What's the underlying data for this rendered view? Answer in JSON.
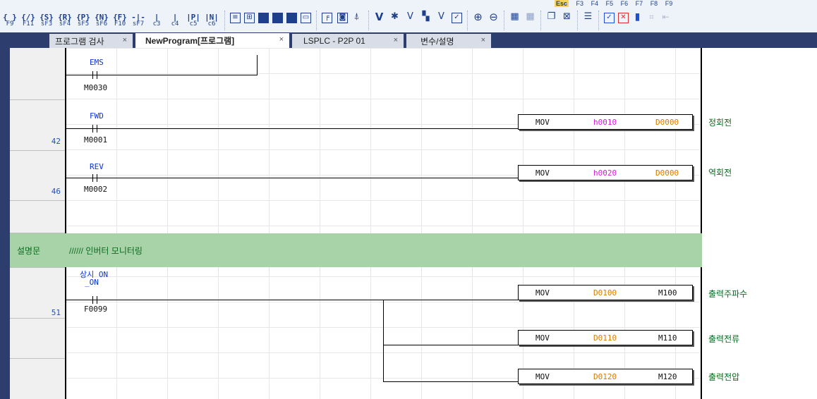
{
  "toolbar": {
    "fkeys_row1": [
      "Esc",
      "F3",
      "F4",
      "F5",
      "F6",
      "F7",
      "F8",
      "F9"
    ],
    "contact_buttons": [
      {
        "icon": "{ }",
        "key": "F9"
      },
      {
        "icon": "{/}",
        "key": "F11"
      },
      {
        "icon": "{S}",
        "key": "sF3"
      },
      {
        "icon": "{R}",
        "key": "sF4"
      },
      {
        "icon": "{P}",
        "key": "sF5"
      },
      {
        "icon": "{N}",
        "key": "sF6"
      },
      {
        "icon": "{F}",
        "key": "F10"
      },
      {
        "icon": "-|-",
        "key": "sF7"
      },
      {
        "icon": "|",
        "key": "c3"
      },
      {
        "icon": "|",
        "key": "c4"
      },
      {
        "icon": "|P|",
        "key": "c5"
      },
      {
        "icon": "|N|",
        "key": "c6"
      }
    ]
  },
  "tabs": [
    {
      "label": "프로그램 검사",
      "close": "×"
    },
    {
      "label": "NewProgram[프로그램]",
      "close": "×"
    },
    {
      "label": "LSPLC - P2P 01",
      "close": "×"
    },
    {
      "label": "변수/설명",
      "close": "×"
    }
  ],
  "ladder": {
    "rung1": {
      "name": "EMS",
      "addr": "M0030"
    },
    "rung2": {
      "step": "42",
      "name": "FWD",
      "addr": "M0001",
      "box": {
        "op": "MOV",
        "src": "h0010",
        "dst": "D0000"
      },
      "comment": "정회전"
    },
    "rung3": {
      "step": "46",
      "name": "REV",
      "addr": "M0002",
      "box": {
        "op": "MOV",
        "src": "h0020",
        "dst": "D0000"
      },
      "comment": "역회전"
    },
    "banner": {
      "label": "설명문",
      "text": "////// 인버터 모니터링"
    },
    "rung4": {
      "step": "51",
      "name1": "상시 ON",
      "name2": "_ON",
      "addr": "F0099",
      "boxes": [
        {
          "op": "MOV",
          "src": "D0100",
          "dst": "M100",
          "comment": "출력주파수"
        },
        {
          "op": "MOV",
          "src": "D0110",
          "dst": "M110",
          "comment": "출력전류"
        },
        {
          "op": "MOV",
          "src": "D0120",
          "dst": "M120",
          "comment": "출력전압"
        }
      ]
    }
  },
  "colors": {
    "hex_constant": "#d81bd8",
    "device": "#d97a00",
    "comment": "#0a6b1f",
    "banner": "#a8d3a8",
    "contact_name": "#0a34d6"
  }
}
